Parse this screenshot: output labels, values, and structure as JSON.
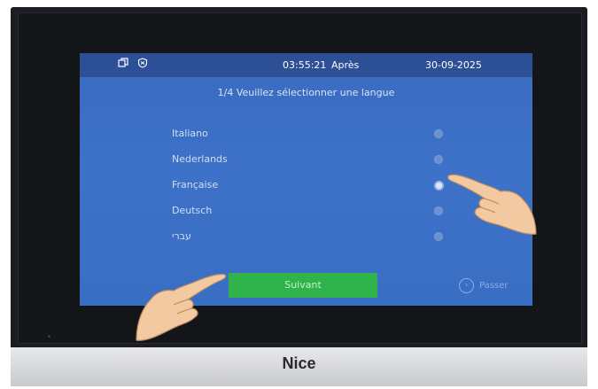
{
  "brand": "Nice",
  "status_bar": {
    "icons": [
      "window-icon",
      "shield-icon"
    ],
    "time": "03:55:21",
    "ampm": "Après",
    "date": "30-09-2025"
  },
  "title": "1/4 Veuillez sélectionner une langue",
  "languages": [
    {
      "label": "Italiano",
      "selected": false
    },
    {
      "label": "Nederlands",
      "selected": false
    },
    {
      "label": "Française",
      "selected": true
    },
    {
      "label": "Deutsch",
      "selected": false
    },
    {
      "label": "עברי",
      "selected": false
    }
  ],
  "buttons": {
    "next": "Suivant",
    "skip": "Passer",
    "skip_icon": "›"
  },
  "colors": {
    "screen_bg": "#3d72c8",
    "statusbar_bg": "#2d4f96",
    "next_button": "#2fb34a"
  }
}
